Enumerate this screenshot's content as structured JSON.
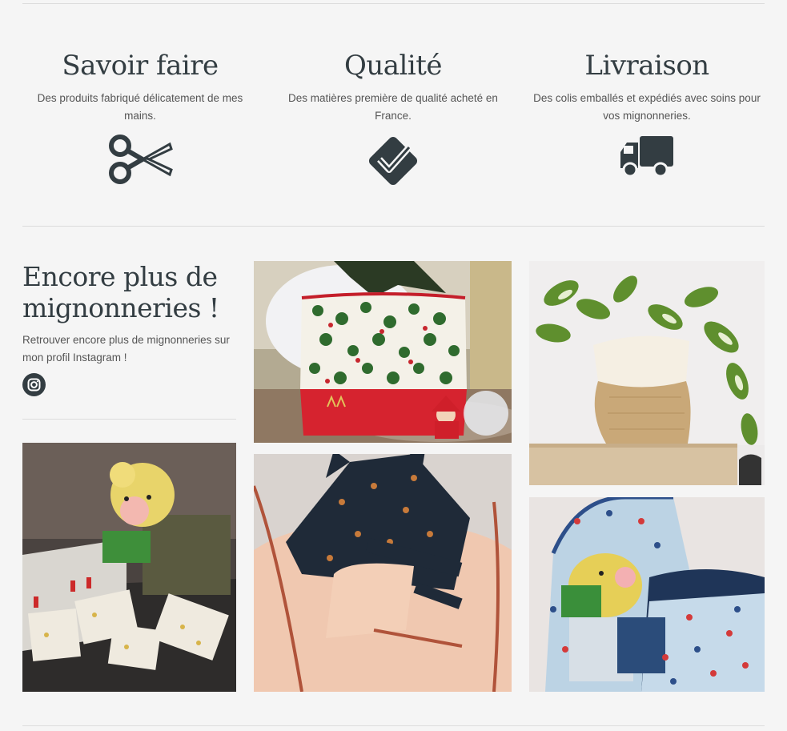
{
  "features": [
    {
      "title": "Savoir faire",
      "text": "Des produits fabriqué délicatement de mes mains.",
      "icon": "scissors-icon"
    },
    {
      "title": "Qualité",
      "text": "Des matières première de qualité acheté en France.",
      "icon": "checkmark-badge-icon"
    },
    {
      "title": "Livraison",
      "text": "Des colis emballés et expédiés avec soins pour vos mignonneries.",
      "icon": "truck-icon"
    }
  ],
  "promo": {
    "title": "Encore plus de mignonneries !",
    "text": "Retrouver encore plus de mignonneries sur mon profil Instagram !",
    "social_icon": "instagram-icon"
  },
  "gallery": [
    {
      "name": "christmas-pouch-photo",
      "subject": "christmas holly pouch"
    },
    {
      "name": "jute-planter-photo",
      "subject": "jute plant pot cover"
    },
    {
      "name": "teddy-washcloths-photo",
      "subject": "teddy with washcloths"
    },
    {
      "name": "hooded-towel-photo",
      "subject": "peach hooded towel"
    },
    {
      "name": "sailor-towel-photo",
      "subject": "sailor print set"
    }
  ],
  "colors": {
    "background": "#f5f5f5",
    "text": "#333d42",
    "divider": "#dcdcdc"
  }
}
